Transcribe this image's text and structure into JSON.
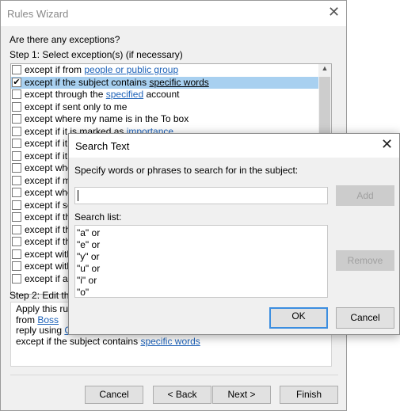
{
  "rules_wizard": {
    "title": "Rules Wizard",
    "question": "Are there any exceptions?",
    "step1_label": "Step 1: Select exception(s) (if necessary)",
    "exceptions": [
      {
        "checked": false,
        "text": "except if from ",
        "link": "people or public group",
        "after": ""
      },
      {
        "checked": true,
        "text": "except if the subject contains ",
        "link": "specific words",
        "after": ""
      },
      {
        "checked": false,
        "text": "except through the ",
        "link": "specified",
        "after": " account"
      },
      {
        "checked": false,
        "text": "except if sent only to me",
        "link": "",
        "after": ""
      },
      {
        "checked": false,
        "text": "except where my name is in the To box",
        "link": "",
        "after": ""
      },
      {
        "checked": false,
        "text": "except if it is marked as ",
        "link": "importance",
        "after": ""
      },
      {
        "checked": false,
        "text": "except if it is",
        "link": "",
        "after": ""
      },
      {
        "checked": false,
        "text": "except if it is",
        "link": "",
        "after": ""
      },
      {
        "checked": false,
        "text": "except wher",
        "link": "",
        "after": ""
      },
      {
        "checked": false,
        "text": "except if my",
        "link": "",
        "after": ""
      },
      {
        "checked": false,
        "text": "except wher",
        "link": "",
        "after": ""
      },
      {
        "checked": false,
        "text": "except if ser",
        "link": "",
        "after": ""
      },
      {
        "checked": false,
        "text": "except if the",
        "link": "",
        "after": ""
      },
      {
        "checked": false,
        "text": "except if the",
        "link": "",
        "after": ""
      },
      {
        "checked": false,
        "text": "except if the",
        "link": "",
        "after": ""
      },
      {
        "checked": false,
        "text": "except with",
        "link": "",
        "after": ""
      },
      {
        "checked": false,
        "text": "except with",
        "link": "",
        "after": ""
      },
      {
        "checked": false,
        "text": "except if ass",
        "link": "",
        "after": ""
      }
    ],
    "step2_label": "Step 2: Edit the r",
    "description": {
      "line1": "Apply this rule",
      "line2_text": "from ",
      "line2_link": "Boss",
      "line3_text": "reply using ",
      "line3_link": "C:\\",
      "line4_text": "except if the subject contains ",
      "line4_link": "specific words"
    },
    "buttons": {
      "cancel": "Cancel",
      "back": "< Back",
      "next": "Next >",
      "finish": "Finish"
    }
  },
  "search_dialog": {
    "title": "Search Text",
    "prompt": "Specify words or phrases to search for in the subject:",
    "input_value": "",
    "add_label": "Add",
    "search_list_label": "Search list:",
    "search_list": [
      "\"a\" or",
      "\"e\" or",
      "\"y\" or",
      "\"u\" or",
      "\"i\" or",
      "\"o\""
    ],
    "remove_label": "Remove",
    "ok_label": "OK",
    "cancel_label": "Cancel"
  },
  "colors": {
    "link": "#1e62b8",
    "selection": "#a8d0f0",
    "default_button_border": "#3c8ee0"
  }
}
